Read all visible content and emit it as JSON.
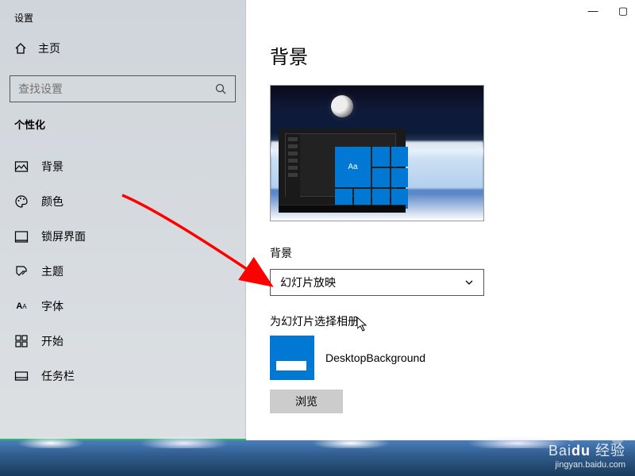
{
  "window": {
    "app_title": "设置",
    "minimize": "—",
    "maximize": "▢"
  },
  "sidebar": {
    "home": "主页",
    "search_placeholder": "查找设置",
    "category": "个性化",
    "items": [
      {
        "label": "背景"
      },
      {
        "label": "颜色"
      },
      {
        "label": "锁屏界面"
      },
      {
        "label": "主题"
      },
      {
        "label": "字体"
      },
      {
        "label": "开始"
      },
      {
        "label": "任务栏"
      }
    ]
  },
  "content": {
    "title": "背景",
    "preview_tile_text": "Aa",
    "bg_label": "背景",
    "dropdown_value": "幻灯片放映",
    "album_label": "为幻灯片选择相册",
    "album_name": "DesktopBackground",
    "browse": "浏览"
  },
  "watermark": {
    "brand_a": "Bai",
    "brand_b": "du",
    "brand_cn": "经验",
    "url": "jingyan.baidu.com"
  }
}
